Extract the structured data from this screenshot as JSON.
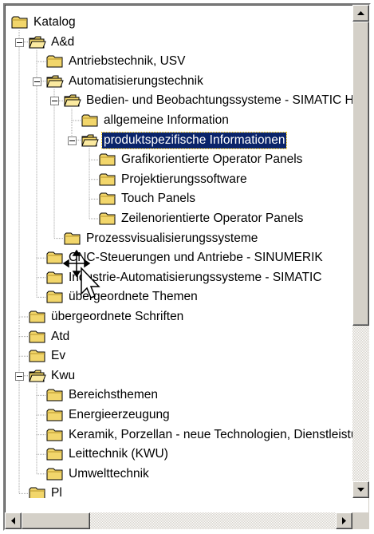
{
  "tree": {
    "nodes": [
      {
        "label": "Katalog",
        "depth": 0,
        "expandable": false,
        "open": false,
        "selected": false
      },
      {
        "label": "A&d",
        "depth": 1,
        "expandable": true,
        "open": true,
        "selected": false
      },
      {
        "label": "Antriebstechnik, USV",
        "depth": 2,
        "expandable": false,
        "open": false,
        "selected": false
      },
      {
        "label": "Automatisierungstechnik",
        "depth": 2,
        "expandable": true,
        "open": true,
        "selected": false
      },
      {
        "label": "Bedien- und Beobachtungssysteme - SIMATIC HMI",
        "depth": 3,
        "expandable": true,
        "open": true,
        "selected": false
      },
      {
        "label": "allgemeine Information",
        "depth": 4,
        "expandable": false,
        "open": false,
        "selected": false
      },
      {
        "label": "produktspezifische Informationen",
        "depth": 4,
        "expandable": true,
        "open": true,
        "selected": true
      },
      {
        "label": "Grafikorientierte Operator Panels",
        "depth": 5,
        "expandable": false,
        "open": false,
        "selected": false
      },
      {
        "label": "Projektierungssoftware",
        "depth": 5,
        "expandable": false,
        "open": false,
        "selected": false
      },
      {
        "label": "Touch Panels",
        "depth": 5,
        "expandable": false,
        "open": false,
        "selected": false
      },
      {
        "label": "Zeilenorientierte Operator Panels",
        "depth": 5,
        "expandable": false,
        "open": false,
        "selected": false
      },
      {
        "label": "Prozessvisualisierungssysteme",
        "depth": 3,
        "expandable": false,
        "open": false,
        "selected": false
      },
      {
        "label": "CNC-Steuerungen und Antriebe - SINUMERIK",
        "depth": 2,
        "expandable": false,
        "open": false,
        "selected": false
      },
      {
        "label": "Industrie-Automatisierungssysteme - SIMATIC",
        "depth": 2,
        "expandable": false,
        "open": false,
        "selected": false
      },
      {
        "label": "übergeordnete Themen",
        "depth": 2,
        "expandable": false,
        "open": false,
        "selected": false
      },
      {
        "label": "übergeordnete Schriften",
        "depth": 1,
        "expandable": false,
        "open": false,
        "selected": false
      },
      {
        "label": "Atd",
        "depth": 1,
        "expandable": false,
        "open": false,
        "selected": false
      },
      {
        "label": "Ev",
        "depth": 1,
        "expandable": false,
        "open": false,
        "selected": false
      },
      {
        "label": "Kwu",
        "depth": 1,
        "expandable": true,
        "open": true,
        "selected": false
      },
      {
        "label": "Bereichsthemen",
        "depth": 2,
        "expandable": false,
        "open": false,
        "selected": false
      },
      {
        "label": "Energieerzeugung",
        "depth": 2,
        "expandable": false,
        "open": false,
        "selected": false
      },
      {
        "label": "Keramik, Porzellan - neue Technologien, Dienstleistungen",
        "depth": 2,
        "expandable": false,
        "open": false,
        "selected": false
      },
      {
        "label": "Leittechnik (KWU)",
        "depth": 2,
        "expandable": false,
        "open": false,
        "selected": false
      },
      {
        "label": "Umwelttechnik",
        "depth": 2,
        "expandable": false,
        "open": false,
        "selected": false
      },
      {
        "label": "Pl",
        "depth": 1,
        "expandable": false,
        "open": false,
        "selected": false
      }
    ]
  },
  "colors": {
    "folder_fill": "#f2d66b",
    "folder_dark": "#b8952b",
    "selection_bg": "#0a246a",
    "tree_line": "#a0a0a0"
  },
  "scrollbars": {
    "vertical_position": 0.0,
    "horizontal_position": 0.0
  },
  "cursor": "move-drag-cursor-icon"
}
